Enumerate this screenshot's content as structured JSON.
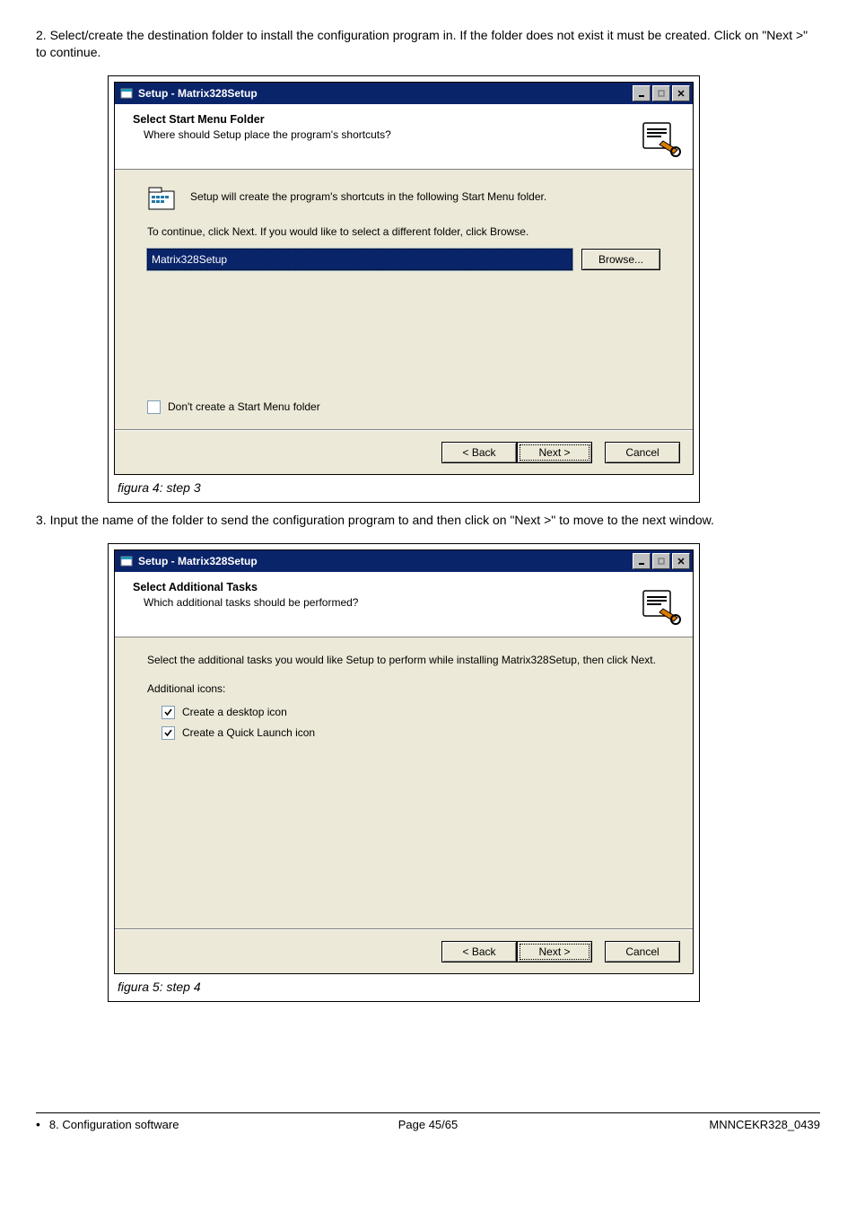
{
  "intro2": "2. Select/create the destination folder to install the configuration program in. If the folder does not exist it must be created. Click on \"Next >\" to continue.",
  "dialog1": {
    "title": "Setup - Matrix328Setup",
    "header_title": "Select Start Menu Folder",
    "header_sub": "Where should Setup place the program's shortcuts?",
    "intro_text": "Setup will create the program's shortcuts in the following Start Menu folder.",
    "help_text": "To continue, click Next. If you would like to select a different folder, click Browse.",
    "input_value": "Matrix328Setup",
    "browse": "Browse...",
    "dont_create": "Don't create a Start Menu folder",
    "back": "< Back",
    "next": "Next >",
    "cancel": "Cancel",
    "caption": "figura 4: step 3"
  },
  "intro3": "3. Input the name of the folder to send the configuration program to and then click on \"Next >\" to move to the next window.",
  "dialog2": {
    "title": "Setup - Matrix328Setup",
    "header_title": "Select Additional Tasks",
    "header_sub": "Which additional tasks should be performed?",
    "intro_text": "Select the additional tasks you would like Setup to perform while installing Matrix328Setup, then click Next.",
    "section": "Additional icons:",
    "opt1": "Create a desktop icon",
    "opt2": "Create a Quick Launch icon",
    "back": "< Back",
    "next": "Next >",
    "cancel": "Cancel",
    "caption": "figura 5: step 4"
  },
  "footer": {
    "section": "8. Configuration software",
    "page": "Page 45/65",
    "doc": "MNNCEKR328_0439"
  }
}
